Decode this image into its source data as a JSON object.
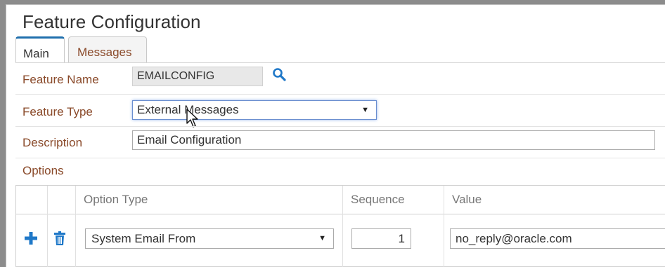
{
  "page": {
    "title": "Feature Configuration"
  },
  "tabs": [
    {
      "label": "Main",
      "active": true
    },
    {
      "label": "Messages",
      "active": false
    }
  ],
  "form": {
    "feature_name": {
      "label": "Feature Name",
      "value": "EMAILCONFIG"
    },
    "feature_type": {
      "label": "Feature Type",
      "value": "External Messages"
    },
    "description": {
      "label": "Description",
      "value": "Email Configuration"
    },
    "options_label": "Options"
  },
  "options_grid": {
    "columns": [
      "Option Type",
      "Sequence",
      "Value"
    ],
    "rows": [
      {
        "option_type": "System Email From",
        "sequence": "1",
        "value": "no_reply@oracle.com"
      }
    ]
  },
  "icons": {
    "search": "search-icon",
    "add": "plus-icon",
    "delete": "trash-icon",
    "dropdown": "caret-down-icon",
    "pointer": "mouse-cursor-icon"
  },
  "colors": {
    "accent_blue": "#1f6fad",
    "label_brown": "#8a4a2a",
    "focus_border": "#6b8fd0"
  }
}
